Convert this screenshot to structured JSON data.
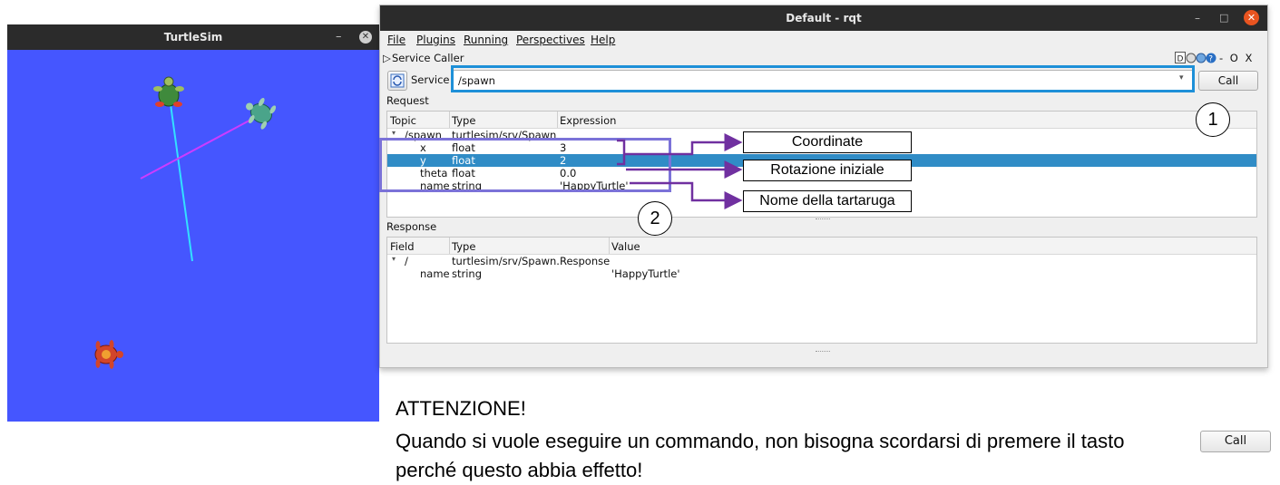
{
  "turtlesim": {
    "title": "TurtleSim",
    "minimize": "–",
    "close": "✕",
    "background_color": "#4556ff"
  },
  "rqt": {
    "title": "Default - rqt",
    "window_controls": {
      "minimize": "–",
      "maximize": "□",
      "close": "✕"
    },
    "menu": [
      "File",
      "Plugins",
      "Running",
      "Perspectives",
      "Help"
    ],
    "plugin_title": "Service Caller",
    "plugin_controls": "- O X",
    "service_label": "Service",
    "service_value": "/spawn",
    "call_label": "Call",
    "request_label": "Request",
    "request_headers": [
      "Topic",
      "Type",
      "Expression"
    ],
    "request_rows": [
      {
        "topic": "/spawn",
        "type": "turtlesim/srv/Spawn",
        "expression": ""
      },
      {
        "topic": "x",
        "type": "float",
        "expression": "3"
      },
      {
        "topic": "y",
        "type": "float",
        "expression": "2"
      },
      {
        "topic": "theta",
        "type": "float",
        "expression": "0.0"
      },
      {
        "topic": "name",
        "type": "string",
        "expression": "'HappyTurtle'"
      }
    ],
    "response_label": "Response",
    "response_headers": [
      "Field",
      "Type",
      "Value"
    ],
    "response_rows": [
      {
        "field": "/",
        "type": "turtlesim/srv/Spawn.Response",
        "value": ""
      },
      {
        "field": "name",
        "type": "string",
        "value": "'HappyTurtle'"
      }
    ],
    "selected_row_color": "#308cc6"
  },
  "annotations": {
    "coordinate": "Coordinate",
    "rotation": "Rotazione iniziale",
    "name": "Nome della tartaruga",
    "marker_1": "1",
    "marker_2": "2",
    "highlight_blue": "#1e90d8",
    "highlight_purple": "#7b72d8",
    "arrow_color": "#7030a0"
  },
  "notice": {
    "title": "ATTENZIONE!",
    "line1": "Quando si vuole eseguire un commando, non bisogna scordarsi di premere il tasto",
    "line2": "perché questo abbia effetto!",
    "button": "Call"
  }
}
